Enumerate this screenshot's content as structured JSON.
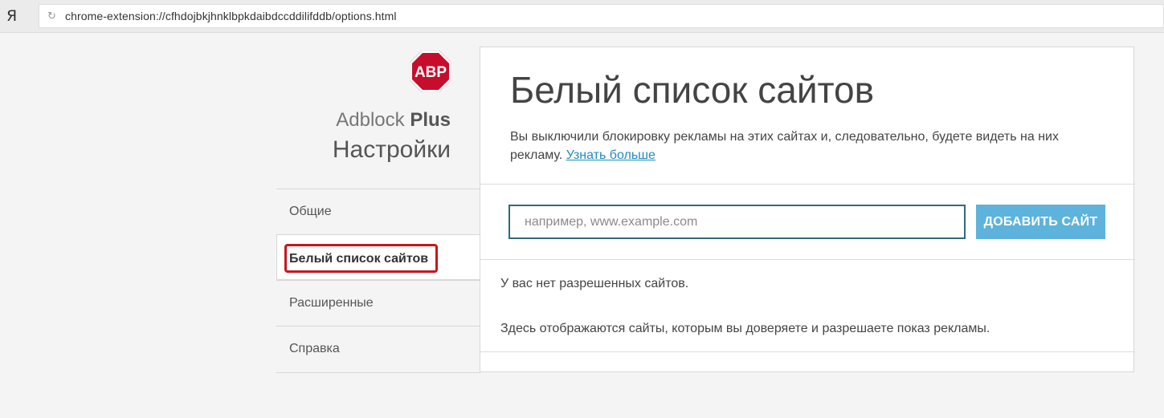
{
  "browser": {
    "logo_text": "Я",
    "url": "chrome-extension://cfhdojbkjhnklbpkdaibdccddilifddb/options.html"
  },
  "sidebar": {
    "logo_text": "ABP",
    "brand_light": "Adblock",
    "brand_bold": "Plus",
    "title": "Настройки",
    "items": [
      {
        "label": "Общие"
      },
      {
        "label": "Белый список сайтов"
      },
      {
        "label": "Расширенные"
      },
      {
        "label": "Справка"
      }
    ],
    "active_index": 1
  },
  "panel": {
    "title": "Белый список сайтов",
    "description": "Вы выключили блокировку рекламы на этих сайтах и, следовательно, будете видеть на них рекламу.",
    "learn_more": "Узнать больше",
    "input_value": "",
    "input_placeholder": "например, www.example.com",
    "add_button": "ДОБАВИТЬ САЙТ",
    "empty_message": "У вас нет разрешенных сайтов.",
    "hint_message": "Здесь отображаются сайты, которым вы доверяете и разрешаете показ рекламы."
  },
  "colors": {
    "abp_red": "#c70d2c",
    "accent_blue": "#5db3dc",
    "link_blue": "#1f8bc0",
    "highlight_red": "#c6171d"
  }
}
